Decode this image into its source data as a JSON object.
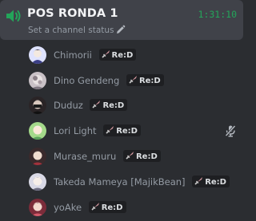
{
  "channel": {
    "name": "POS RONDA 1",
    "timer": "1:31:10",
    "status_placeholder": "Set a channel status",
    "icon": "speaker-icon",
    "accent": "#23a55a"
  },
  "role_badge": {
    "label": "Re:D",
    "icon": "sword-icon"
  },
  "users": [
    {
      "name": "Chimorii",
      "role": "Re:D",
      "muted": false,
      "avatar_color": "#dfe3ff"
    },
    {
      "name": "Dino Gendeng",
      "role": "Re:D",
      "muted": false,
      "avatar_color": "#c9c1c6"
    },
    {
      "name": "Duduz",
      "role": "Re:D",
      "muted": false,
      "avatar_color": "#2a2426"
    },
    {
      "name": "Lori Light",
      "role": "Re:D",
      "muted": true,
      "avatar_color": "#a4d98a"
    },
    {
      "name": "Murase_muru",
      "role": "Re:D",
      "muted": false,
      "avatar_color": "#3a2a2c"
    },
    {
      "name": "Takeda Mameya [MajikBean]",
      "role": "Re:D",
      "muted": false,
      "avatar_color": "#d9d9e6"
    },
    {
      "name": "yoAke",
      "role": "Re:D",
      "muted": false,
      "avatar_color": "#7c2c3a"
    }
  ]
}
